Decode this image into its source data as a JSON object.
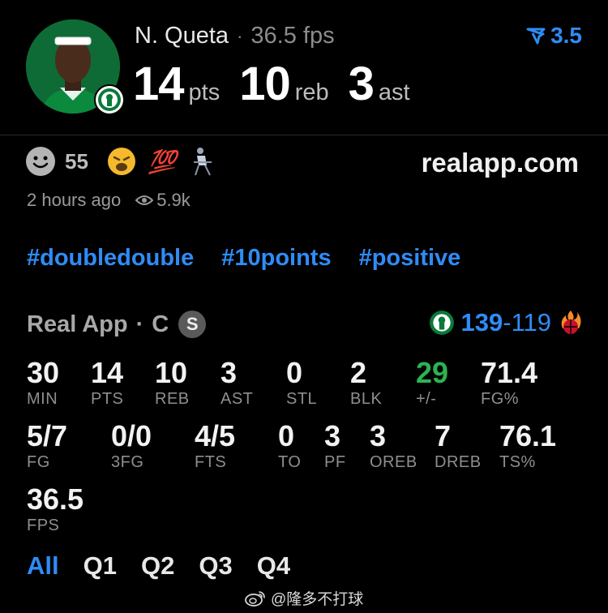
{
  "header": {
    "player_name": "N. Queta",
    "separator": "·",
    "fps": "36.5 fps",
    "boost": "3.5",
    "points_value": "14",
    "points_unit": "pts",
    "rebounds_value": "10",
    "rebounds_unit": "reb",
    "assists_value": "3",
    "assists_unit": "ast"
  },
  "post": {
    "reaction_count": "55",
    "site": "realapp.com",
    "time_ago": "2 hours ago",
    "views": "5.9k",
    "emoji_100": "💯"
  },
  "hashtags": [
    "#doubledouble",
    "#10points",
    "#positive"
  ],
  "game": {
    "source": "Real App",
    "separator": "·",
    "position": "C",
    "status_badge": "S",
    "home_score": "139",
    "dash": "-",
    "away_score": "119"
  },
  "stats": [
    {
      "value": "30",
      "label": "MIN"
    },
    {
      "value": "14",
      "label": "PTS"
    },
    {
      "value": "10",
      "label": "REB"
    },
    {
      "value": "3",
      "label": "AST"
    },
    {
      "value": "0",
      "label": "STL"
    },
    {
      "value": "2",
      "label": "BLK"
    },
    {
      "value": "29",
      "label": "+/-"
    },
    {
      "value": "71.4",
      "label": "FG%"
    },
    {
      "value": "5/7",
      "label": "FG"
    },
    {
      "value": "0/0",
      "label": "3FG"
    },
    {
      "value": "4/5",
      "label": "FTS"
    },
    {
      "value": "0",
      "label": "TO"
    },
    {
      "value": "3",
      "label": "PF"
    },
    {
      "value": "3",
      "label": "OREB"
    },
    {
      "value": "7",
      "label": "DREB"
    },
    {
      "value": "76.1",
      "label": "TS%"
    },
    {
      "value": "36.5",
      "label": "FPS"
    }
  ],
  "tabs": [
    "All",
    "Q1",
    "Q2",
    "Q3",
    "Q4"
  ],
  "watermark": "@隆多不打球",
  "colors": {
    "accent": "#2f8cf6",
    "positive": "#2eb34f",
    "background": "#000000"
  }
}
